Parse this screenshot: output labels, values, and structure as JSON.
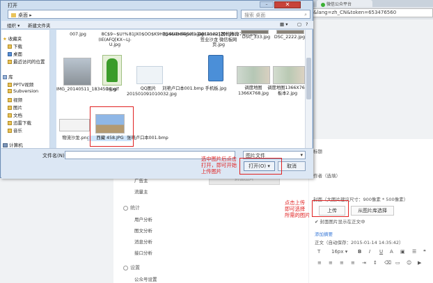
{
  "browser": {
    "tab_label": "微信公众平台",
    "address_tail": "&lang=zh_CN&token=653476560"
  },
  "dialog": {
    "title": "打开",
    "path_text": "桌面",
    "search_placeholder": "搜索 桌面",
    "toolbar": {
      "organize": "组织 ▾",
      "new_folder": "新建文件夹"
    },
    "nav_pane": {
      "favorites_header": "收藏夹",
      "favorites": [
        "下载",
        "桌面",
        "最近访问的位置"
      ],
      "libraries_header": "库",
      "libraries": [
        "PPTV视频",
        "Subversion",
        "视频",
        "图片",
        "文档",
        "迅雷下载",
        "音乐"
      ],
      "computer": "计算机"
    },
    "files": [
      {
        "name": "007.jpg"
      },
      {
        "name": "8C$9~$U!%(IE(AFQ[KX~LJ-U.jpg"
      },
      {
        "name": "81JX0$OO$K9H]@SU1H695(E).jpg"
      },
      {
        "name": "8546ebd4gw1e7ajn1ovscj20by6c37wh.jpg"
      },
      {
        "name": "20141021国代物流签业沙龙 微信板网页.jpg"
      },
      {
        "name": "DSC_333.jpg"
      },
      {
        "name": "DSC_2222.jpg"
      },
      {
        "name": "IMG_20140511_183450.jpg"
      },
      {
        "name": "OK.gif"
      },
      {
        "name": "QQ图片201501091010032.jpg"
      },
      {
        "name": "刘艳卢口本001.bmp"
      },
      {
        "name": "手机板.jpg"
      },
      {
        "name": "调度地图1366X768.jpg"
      },
      {
        "name": "调度地图1366X768板本2.jpg"
      },
      {
        "name": "物流沙龙.png"
      },
      {
        "name": "西藏 458.JPG"
      },
      {
        "name": "张晓卢口本001.bmp"
      }
    ],
    "filename_label": "文件名(N):",
    "filename_value": "",
    "filetype_value": "图片文件",
    "open_button": "打开(O)",
    "cancel_button": "取消"
  },
  "annotations": {
    "dialog_note": "选中图片后点击\n打开，即可开始\n上传图片",
    "upload_note": "点击上传\n即可选择\n所需的图片"
  },
  "page": {
    "left_nav": {
      "items_top": [
        "广告主",
        "流量主"
      ],
      "stats_header": "统计",
      "stats_items": [
        "用户分析",
        "图文分析",
        "消息分析",
        "接口分析"
      ],
      "settings_header": "设置",
      "settings_items": [
        "公众号设置"
      ]
    },
    "cover_placeholder": "封面图片",
    "right": {
      "title_label": "标题",
      "author_label": "作者（选填）",
      "cover_label": "封面（大图片建议尺寸：900像素 * 500像素）",
      "upload_button": "上传",
      "library_button": "从图片库选择",
      "show_cover_text": "封面图片显示在正文中",
      "add_summary": "添加摘要",
      "body_label": "正文（自动保存：2015-01-14 14:35:42）",
      "font_size": "16px"
    }
  },
  "colors": {
    "annotation_red": "#e02020",
    "dialog_frame": "#cfdff0",
    "close_red": "#c7433a"
  }
}
